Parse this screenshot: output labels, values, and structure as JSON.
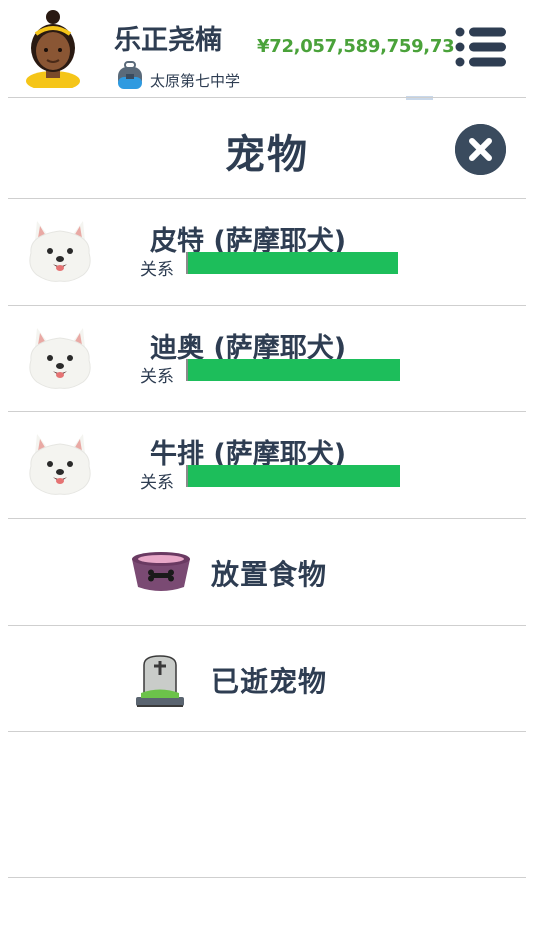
{
  "header": {
    "player_name": "乐正尧楠",
    "school_name": "太原第七中学",
    "money": "¥72,057,589,759,73"
  },
  "page": {
    "title": "宠物"
  },
  "pets": [
    {
      "name": "皮特 (萨摩耶犬)",
      "relationship_label": "关系",
      "relationship_level": 0.99
    },
    {
      "name": "迪奥 (萨摩耶犬)",
      "relationship_label": "关系",
      "relationship_level": 1.0
    },
    {
      "name": "牛排 (萨摩耶犬)",
      "relationship_label": "关系",
      "relationship_level": 1.0
    }
  ],
  "actions": [
    {
      "label": "放置食物",
      "icon": "food-bowl-icon"
    },
    {
      "label": "已逝宠物",
      "icon": "gravestone-icon"
    }
  ],
  "colors": {
    "accent_text": "#2e3d52",
    "money": "#4aa23a",
    "relationship_bar": "#1dbe5b",
    "close_button": "#3a4b5e"
  }
}
